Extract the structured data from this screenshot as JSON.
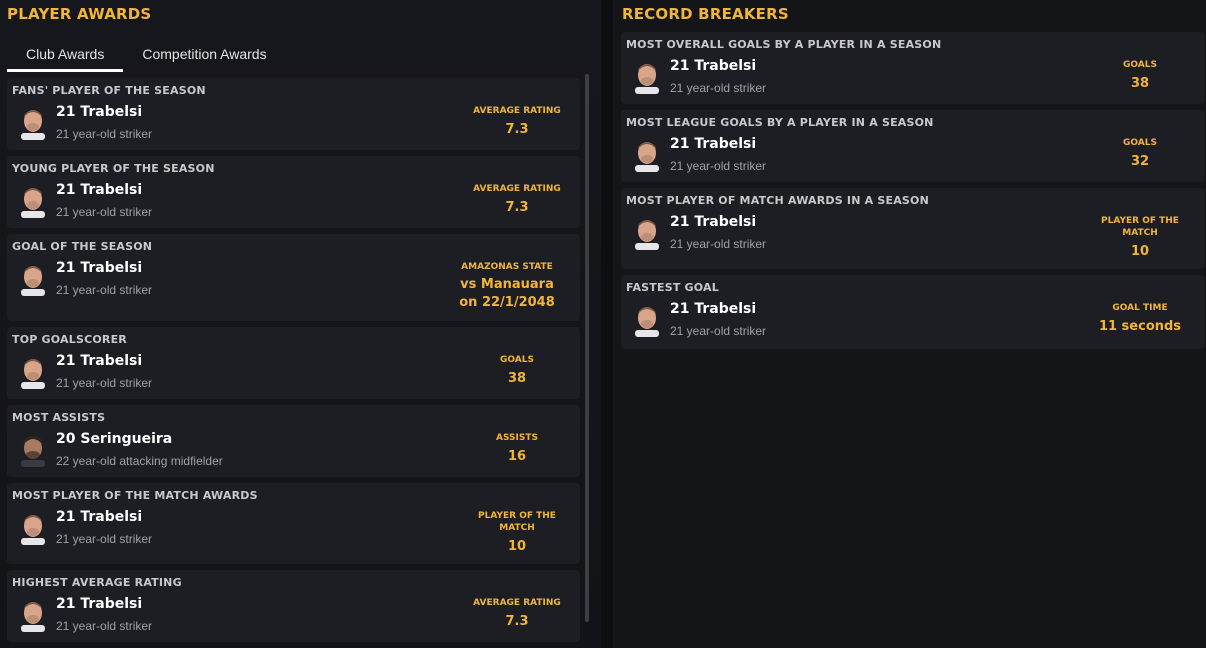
{
  "player_awards": {
    "title": "PLAYER AWARDS",
    "tabs": [
      {
        "label": "Club Awards",
        "active": true
      },
      {
        "label": "Competition Awards",
        "active": false
      }
    ],
    "cards": [
      {
        "title": "FANS' PLAYER OF THE SEASON",
        "player": "21 Trabelsi",
        "desc": "21 year-old striker",
        "stat_label": "AVERAGE RATING",
        "stat_value": "7.3"
      },
      {
        "title": "YOUNG PLAYER OF THE SEASON",
        "player": "21 Trabelsi",
        "desc": "21 year-old striker",
        "stat_label": "AVERAGE RATING",
        "stat_value": "7.3"
      },
      {
        "title": "GOAL OF THE SEASON",
        "player": "21 Trabelsi",
        "desc": "21 year-old striker",
        "stat_label": "AMAZONAS STATE",
        "stat_value_1": "vs Manauara",
        "stat_value_2": "on 22/1/2048"
      },
      {
        "title": "TOP GOALSCORER",
        "player": "21 Trabelsi",
        "desc": "21 year-old striker",
        "stat_label": "GOALS",
        "stat_value": "38"
      },
      {
        "title": "MOST ASSISTS",
        "player": "20 Seringueira",
        "desc": "22 year-old attacking midfielder",
        "stat_label": "ASSISTS",
        "stat_value": "16"
      },
      {
        "title": "MOST PLAYER OF THE MATCH AWARDS",
        "player": "21 Trabelsi",
        "desc": "21 year-old striker",
        "stat_label_1": "PLAYER OF THE",
        "stat_label_2": "MATCH",
        "stat_value": "10"
      },
      {
        "title": "HIGHEST AVERAGE RATING",
        "player": "21 Trabelsi",
        "desc": "21 year-old striker",
        "stat_label": "AVERAGE RATING",
        "stat_value": "7.3"
      }
    ]
  },
  "record_breakers": {
    "title": "RECORD BREAKERS",
    "cards": [
      {
        "title": "MOST OVERALL GOALS BY A PLAYER IN A SEASON",
        "player": "21 Trabelsi",
        "desc": "21 year-old striker",
        "stat_label": "GOALS",
        "stat_value": "38"
      },
      {
        "title": "MOST LEAGUE GOALS BY A PLAYER IN A SEASON",
        "player": "21 Trabelsi",
        "desc": "21 year-old striker",
        "stat_label": "GOALS",
        "stat_value": "32"
      },
      {
        "title": "MOST PLAYER OF MATCH AWARDS IN A SEASON",
        "player": "21 Trabelsi",
        "desc": "21 year-old striker",
        "stat_label_1": "PLAYER OF THE",
        "stat_label_2": "MATCH",
        "stat_value": "10"
      },
      {
        "title": "FASTEST GOAL",
        "player": "21 Trabelsi",
        "desc": "21 year-old striker",
        "stat_label": "GOAL TIME",
        "stat_value": "11 seconds"
      }
    ]
  },
  "colors": {
    "accent": "#f0b53a",
    "card": "#1d1e23",
    "background": "#131419"
  },
  "icons": {
    "player_photo_light": "player-photo-icon",
    "player_photo_dark": "player-photo-icon"
  }
}
